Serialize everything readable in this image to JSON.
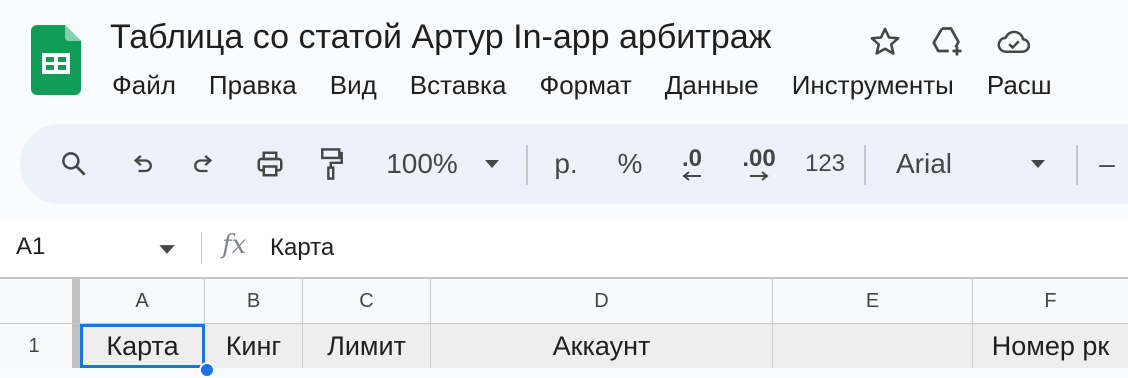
{
  "document": {
    "title": "Таблица со статой Артур In-app арбитраж"
  },
  "menu": {
    "items": [
      "Файл",
      "Правка",
      "Вид",
      "Вставка",
      "Формат",
      "Данные",
      "Инструменты",
      "Расш"
    ]
  },
  "toolbar": {
    "zoom": "100%",
    "currency": "р.",
    "percent": "%",
    "decrease_decimals": ".0",
    "increase_decimals": ".00",
    "number_format": "123",
    "font": "Arial",
    "minus": "–"
  },
  "formula_bar": {
    "cell_ref": "A1",
    "fx_label": "fx",
    "value": "Карта"
  },
  "grid": {
    "columns": [
      "A",
      "B",
      "C",
      "D",
      "E",
      "F"
    ],
    "rows": [
      {
        "number": "1",
        "cells": [
          "Карта",
          "Кинг",
          "Лимит",
          "Аккаунт",
          "",
          "Номер рк"
        ]
      }
    ]
  },
  "colors": {
    "logo_green": "#0f9d58",
    "toolbar_bg": "#edf2fa",
    "selection": "#1a73e8"
  }
}
